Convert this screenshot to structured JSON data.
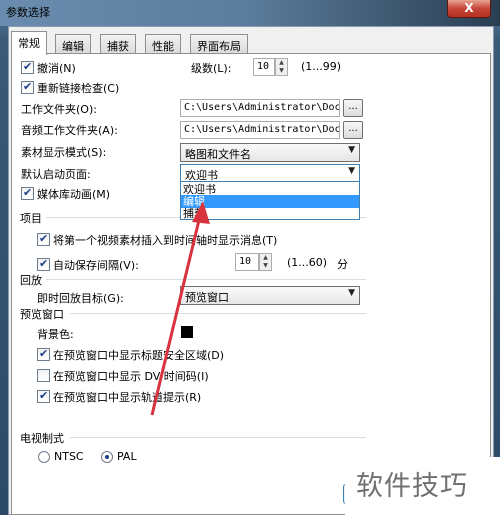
{
  "window": {
    "title": "参数选择",
    "close_label": "X"
  },
  "tabs": [
    {
      "label": "常规",
      "active": true
    },
    {
      "label": "编辑",
      "active": false
    },
    {
      "label": "捕获",
      "active": false
    },
    {
      "label": "性能",
      "active": false
    },
    {
      "label": "界面布局",
      "active": false
    }
  ],
  "general": {
    "undo": {
      "label": "撤消(N)",
      "checked": true
    },
    "levels": {
      "label": "级数(L):",
      "value": "10",
      "range": "(1...99)"
    },
    "relink": {
      "label": "重新链接检查(C)",
      "checked": true
    },
    "work_folder": {
      "label": "工作文件夹(O):",
      "value": "C:\\Users\\Administrator\\Docum",
      "browse": "..."
    },
    "audio_folder": {
      "label": "音频工作文件夹(A):",
      "value": "C:\\Users\\Administrator\\Docum",
      "browse": "..."
    },
    "clip_display": {
      "label": "素材显示模式(S):",
      "value": "略图和文件名"
    },
    "start_page": {
      "label": "默认启动页面:",
      "value": "欢迎书",
      "options": [
        "欢迎书",
        "编辑",
        "捕获"
      ],
      "highlighted": "编辑"
    },
    "media_anim": {
      "label": "媒体库动画(M)",
      "checked": true
    }
  },
  "project": {
    "title": "项目",
    "insert_first": {
      "label": "将第一个视频素材插入到时间轴时显示消息(T)",
      "checked": true
    },
    "autosave": {
      "label": "自动保存间隔(V):",
      "checked": true,
      "value": "10",
      "range": "(1...60)",
      "unit": "分"
    }
  },
  "playback": {
    "title": "回放",
    "target": {
      "label": "即时回放目标(G):",
      "value": "预览窗口"
    }
  },
  "preview": {
    "title": "预览窗口",
    "bg_color": {
      "label": "背景色:",
      "color": "#000000"
    },
    "title_safe": {
      "label": "在预览窗口中显示标题安全区域(D)",
      "checked": true
    },
    "dv_timecode": {
      "label": "在预览窗口中显示 DV 时间码(I)",
      "checked": false
    },
    "track_hint": {
      "label": "在预览窗口中显示轨道提示(R)",
      "checked": true
    }
  },
  "tv_system": {
    "title": "电视制式",
    "ntsc": {
      "label": "NTSC",
      "checked": false
    },
    "pal": {
      "label": "PAL",
      "checked": true
    }
  },
  "watermark": {
    "text": "软件技巧"
  },
  "colors": {
    "accent_arrow": "#d9333f",
    "selection": "#3399ff"
  }
}
